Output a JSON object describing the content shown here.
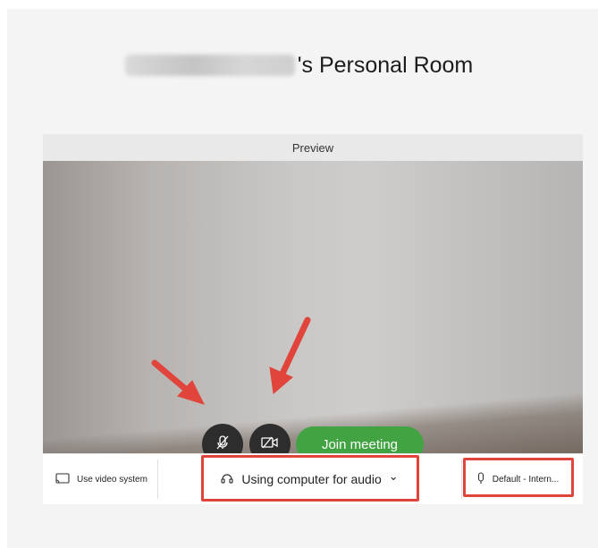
{
  "room": {
    "title_suffix": "'s Personal Room"
  },
  "preview": {
    "header": "Preview"
  },
  "controls": {
    "mute_icon": "microphone-muted-icon",
    "video_icon": "video-off-icon",
    "join_label": "Join meeting",
    "join_color": "#42a342"
  },
  "bottom_bar": {
    "use_video_label": "Use video system",
    "audio_label": "Using computer for audio",
    "audio_chevron": "⌄",
    "mic_label": "Default - Intern..."
  },
  "annotation_color": "#e0443b"
}
